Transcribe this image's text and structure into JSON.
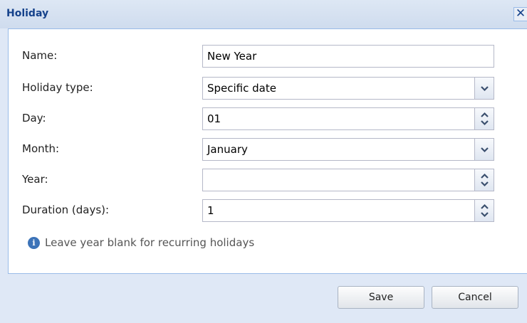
{
  "dialog": {
    "title": "Holiday",
    "close_glyph": "✕"
  },
  "form": {
    "name_label": "Name:",
    "name_value": "New Year",
    "holiday_type_label": "Holiday type:",
    "holiday_type_value": "Specific date",
    "day_label": "Day:",
    "day_value": "01",
    "month_label": "Month:",
    "month_value": "January",
    "year_label": "Year:",
    "year_value": "",
    "duration_label": "Duration (days):",
    "duration_value": "1"
  },
  "info": {
    "icon_glyph": "i",
    "text": "Leave year blank for recurring holidays"
  },
  "buttons": {
    "save_label": "Save",
    "cancel_label": "Cancel"
  },
  "icons": {
    "close": "close-icon",
    "info": "info-icon",
    "dropdown": "chevron-down-icon",
    "spinner": "spinner-arrows-icon"
  },
  "colors": {
    "title_text": "#15428b",
    "window_background": "#dfe8f6",
    "border": "#99bbe8",
    "info_icon": "#3c73b8"
  }
}
